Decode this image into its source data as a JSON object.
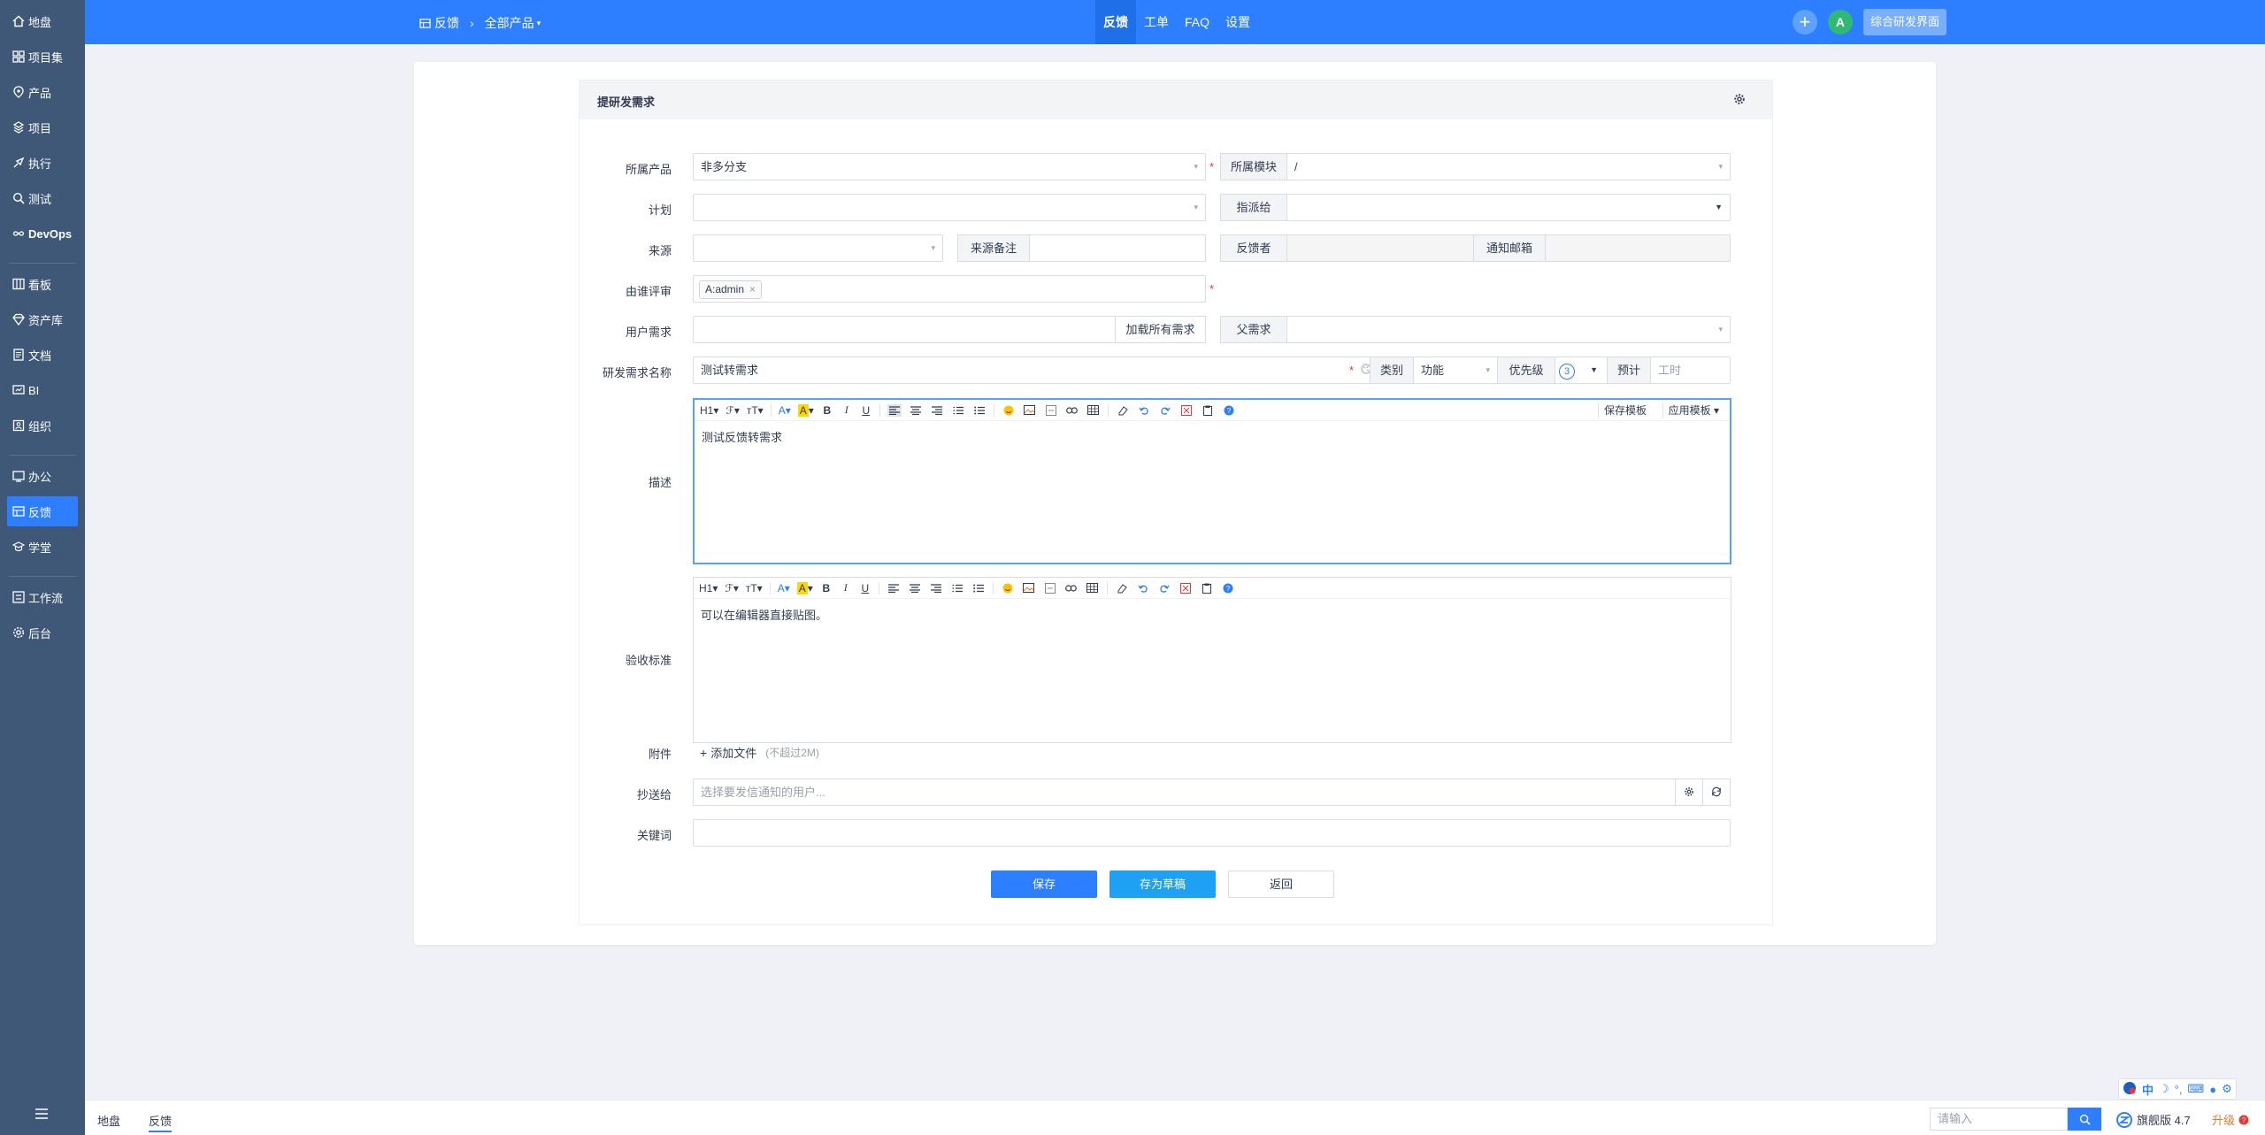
{
  "sidebar": {
    "items": [
      {
        "label": "地盘",
        "icon": "home-icon"
      },
      {
        "label": "项目集",
        "icon": "grid-icon"
      },
      {
        "label": "产品",
        "icon": "tag-icon"
      },
      {
        "label": "项目",
        "icon": "stack-icon"
      },
      {
        "label": "执行",
        "icon": "rocket-icon"
      },
      {
        "label": "测试",
        "icon": "search-icon"
      },
      {
        "label": "DevOps",
        "icon": "infinity-icon"
      },
      {
        "label": "看板",
        "icon": "kanban-icon"
      },
      {
        "label": "资产库",
        "icon": "diamond-icon"
      },
      {
        "label": "文档",
        "icon": "doc-icon"
      },
      {
        "label": "BI",
        "icon": "chart-icon"
      },
      {
        "label": "组织",
        "icon": "org-icon"
      },
      {
        "label": "办公",
        "icon": "office-icon"
      },
      {
        "label": "反馈",
        "icon": "feedback-icon"
      },
      {
        "label": "学堂",
        "icon": "school-icon"
      },
      {
        "label": "工作流",
        "icon": "workflow-icon"
      },
      {
        "label": "后台",
        "icon": "gear-icon"
      }
    ],
    "active": "反馈"
  },
  "header": {
    "breadcrumb": {
      "module": "反馈",
      "product": "全部产品"
    },
    "tabs": [
      "反馈",
      "工单",
      "FAQ",
      "设置"
    ],
    "active_tab": "反馈",
    "avatar_letter": "A",
    "switch_label": "综合研发界面"
  },
  "form": {
    "title": "提研发需求",
    "product_label": "所属产品",
    "product_value": "非多分支",
    "module_label": "所属模块",
    "module_value": "/",
    "plan_label": "计划",
    "assign_label": "指派给",
    "source_label": "来源",
    "source_note_label": "来源备注",
    "feedback_by_label": "反馈者",
    "notify_email_label": "通知邮箱",
    "reviewer_label": "由谁评审",
    "reviewer_tag": "A:admin",
    "user_req_label": "用户需求",
    "load_all_label": "加载所有需求",
    "parent_label": "父需求",
    "name_label": "研发需求名称",
    "name_value": "测试转需求",
    "category_label": "类别",
    "category_value": "功能",
    "priority_label": "优先级",
    "priority_value": "3",
    "estimate_label": "预计",
    "estimate_placeholder": "工时",
    "desc_label": "描述",
    "desc_value": "测试反馈转需求",
    "accept_label": "验收标准",
    "accept_placeholder": "可以在编辑器直接贴图。",
    "attach_label": "附件",
    "add_file_label": "添加文件",
    "add_file_hint": "(不超过2M)",
    "cc_label": "抄送给",
    "cc_placeholder": "选择要发信通知的用户...",
    "keywords_label": "关键词",
    "save_label": "保存",
    "draft_label": "存为草稿",
    "back_label": "返回"
  },
  "editor_toolbar": {
    "h1": "H1",
    "font": "ℱ",
    "size": "тT",
    "font_color": "A",
    "bg_color": "A",
    "bold": "B",
    "italic": "I",
    "underline": "U",
    "save_template": "保存模板",
    "apply_template": "应用模板"
  },
  "bottombar": {
    "crumbs": [
      "地盘",
      "反馈"
    ],
    "search_placeholder": "请输入",
    "version": "旗舰版 4.7",
    "upgrade": "升级"
  },
  "ime": {
    "lang": "中"
  },
  "colors": {
    "primary": "#2e7fff",
    "sidebar": "#3f5877",
    "required": "#e53935",
    "draft_button": "#1ea1f2"
  }
}
